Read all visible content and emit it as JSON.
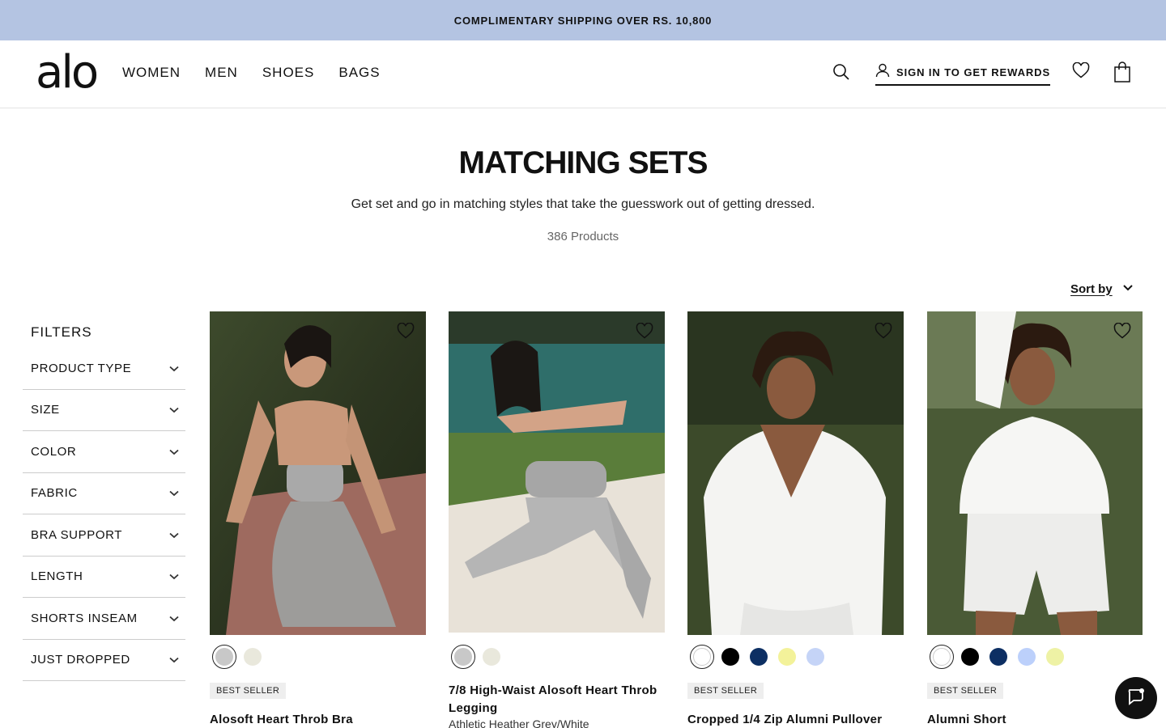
{
  "promo": {
    "text": "COMPLIMENTARY SHIPPING OVER RS. 10,800"
  },
  "header": {
    "logo": "alo",
    "nav": [
      "WOMEN",
      "MEN",
      "SHOES",
      "BAGS"
    ],
    "account_label": "SIGN IN TO GET REWARDS",
    "icons": [
      "search-icon",
      "user-icon",
      "heart-icon",
      "bag-icon"
    ]
  },
  "page": {
    "title": "MATCHING SETS",
    "subtitle": "Get set and go in matching styles that take the guesswork out of getting dressed.",
    "count": "386 Products",
    "sort_label": "Sort by"
  },
  "filters": {
    "title": "FILTERS",
    "items": [
      "PRODUCT TYPE",
      "SIZE",
      "COLOR",
      "FABRIC",
      "BRA SUPPORT",
      "LENGTH",
      "SHORTS INSEAM",
      "JUST DROPPED"
    ]
  },
  "products": [
    {
      "badge": "BEST SELLER",
      "name": "Alosoft Heart Throb Bra",
      "color": "",
      "swatches": [
        "#c8c8c8",
        "#e9e8dc"
      ]
    },
    {
      "badge": "",
      "name": "7/8 High-Waist Alosoft Heart Throb Legging",
      "color": "Athletic Heather Grey/White",
      "swatches": [
        "#c8c8c8",
        "#e9e8dc"
      ]
    },
    {
      "badge": "BEST SELLER",
      "name": "Cropped 1/4 Zip Alumni Pullover",
      "color": "",
      "swatches": [
        "#ffffff",
        "#000000",
        "#0d2f63",
        "#f3f29a",
        "#c5d4f7"
      ]
    },
    {
      "badge": "BEST SELLER",
      "name": "Alumni Short",
      "color": "",
      "swatches": [
        "#ffffff",
        "#000000",
        "#0d2f63",
        "#bcd0fb",
        "#eef2a5"
      ]
    }
  ],
  "colors": {
    "promo_bg": "#b4c4e2",
    "text": "#111111",
    "badge_bg": "#eeeeee"
  }
}
